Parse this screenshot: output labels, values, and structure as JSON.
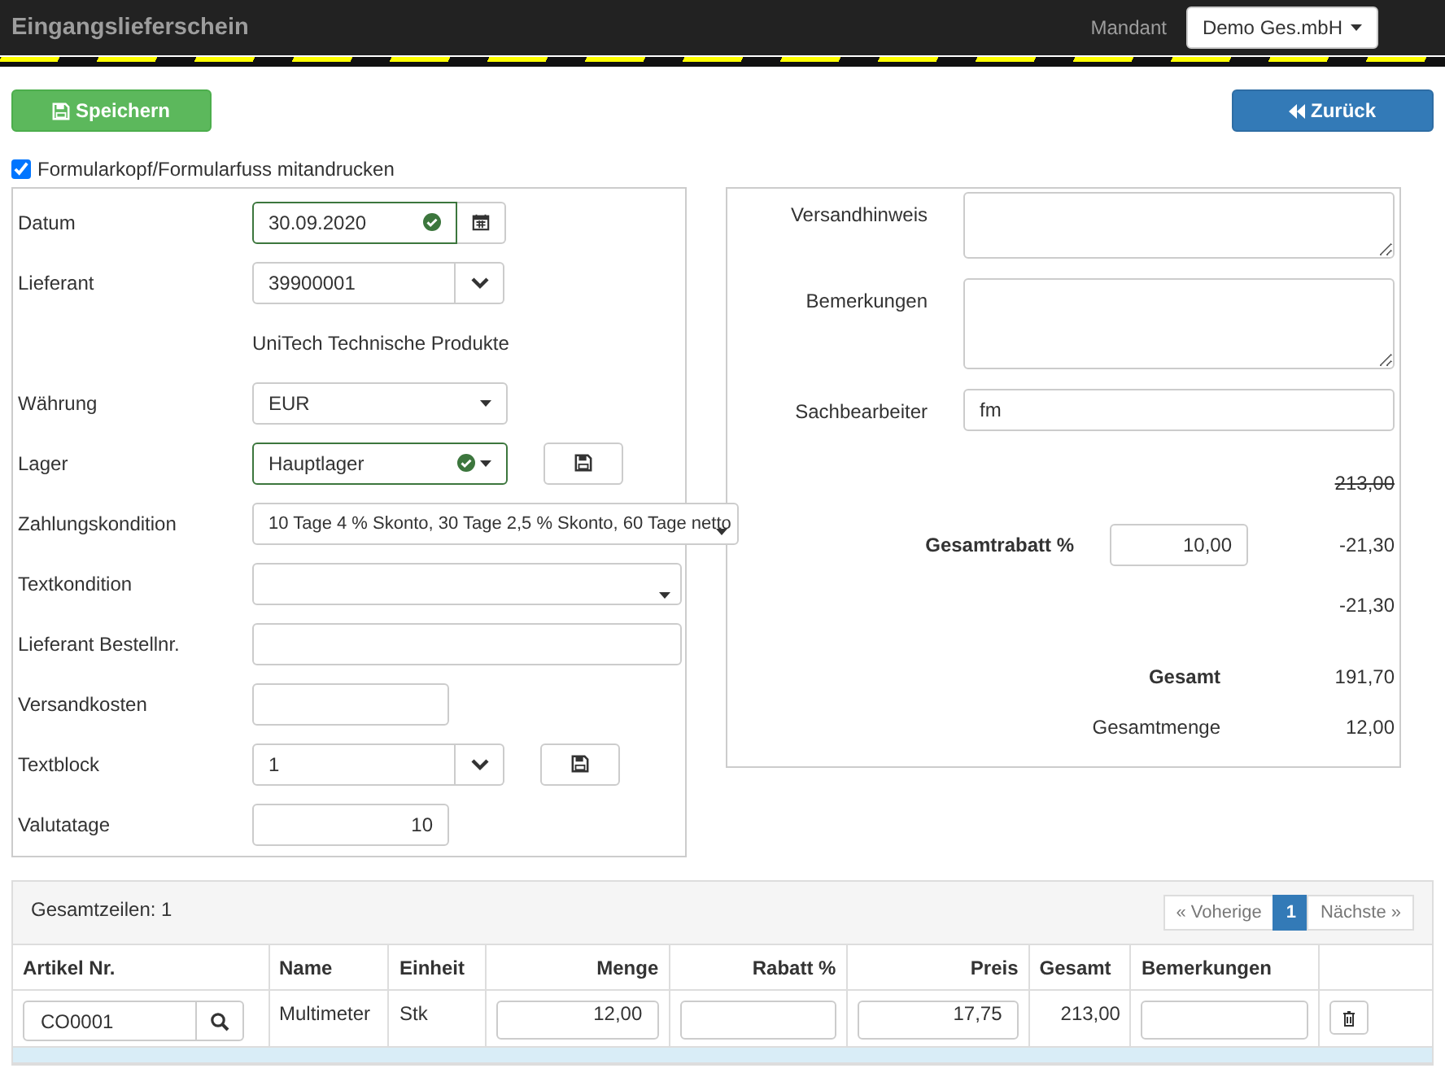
{
  "header": {
    "title": "Eingangslieferschein",
    "mandant_label": "Mandant",
    "mandant_value": "Demo Ges.mbH"
  },
  "buttons": {
    "save": {
      "label": "Speichern"
    },
    "back": {
      "label": "Zurück"
    }
  },
  "print_checkbox": {
    "label": "Formularkopf/Formularfuss mitandrucken",
    "checked": true
  },
  "left_form": [
    {
      "kind": "date",
      "label": "Datum",
      "value": "30.09.2020",
      "valid": true
    },
    {
      "kind": "lookup",
      "label": "Lieferant",
      "value": "39900001",
      "save_button": false
    },
    {
      "kind": "static",
      "value": "UniTech Technische Produkte"
    },
    {
      "kind": "select",
      "label": "Währung",
      "value": "EUR",
      "valid": false,
      "save_button": false
    },
    {
      "kind": "select",
      "label": "Lager",
      "value": "Hauptlager",
      "valid": true,
      "save_button": true
    },
    {
      "kind": "longselect",
      "label": "Zahlungskondition",
      "value": "10 Tage 4 % Skonto, 30 Tage 2,5 % Skonto, 60 Tage netto"
    },
    {
      "kind": "longselect",
      "label": "Textkondition"
    },
    {
      "kind": "wideinput",
      "label": "Lieferant Bestellnr."
    },
    {
      "kind": "input",
      "label": "Versandkosten"
    },
    {
      "kind": "lookup",
      "label": "Textblock",
      "value": "1",
      "save_button": true
    },
    {
      "kind": "number",
      "label": "Valutatage",
      "value": "10"
    }
  ],
  "right_form": [
    {
      "kind": "textarea",
      "label": "Versandhinweis"
    },
    {
      "kind": "textarea",
      "label": "Bemerkungen"
    },
    {
      "kind": "input",
      "label": "Sachbearbeiter",
      "value": "fm"
    }
  ],
  "totals": {
    "subtotal": "213,00",
    "discount": {
      "label": "Gesamtrabatt %",
      "value": "10,00",
      "amount": "-21,30"
    },
    "discount_total": "-21,30",
    "total": {
      "label": "Gesamt",
      "value": "191,70"
    },
    "quantity": {
      "label": "Gesamtmenge",
      "value": "12,00"
    }
  },
  "table": {
    "count_label": "Gesamtzeilen: 1",
    "pagination": [
      {
        "label": "« Voherige",
        "selected": false
      },
      {
        "label": "1",
        "selected": true
      },
      {
        "label": "Nächste »",
        "selected": false
      }
    ],
    "columns": [
      "Artikel Nr.",
      "Name",
      "Einheit",
      "Menge",
      "Rabatt %",
      "Preis",
      "Gesamt",
      "Bemerkungen"
    ],
    "rows": [
      {
        "article": "CO0001",
        "name": "Multimeter",
        "unit": "Stk",
        "quantity": "12,00",
        "price": "17,75",
        "total": "213,00",
        "selected": false
      },
      {
        "selected": true
      }
    ]
  }
}
